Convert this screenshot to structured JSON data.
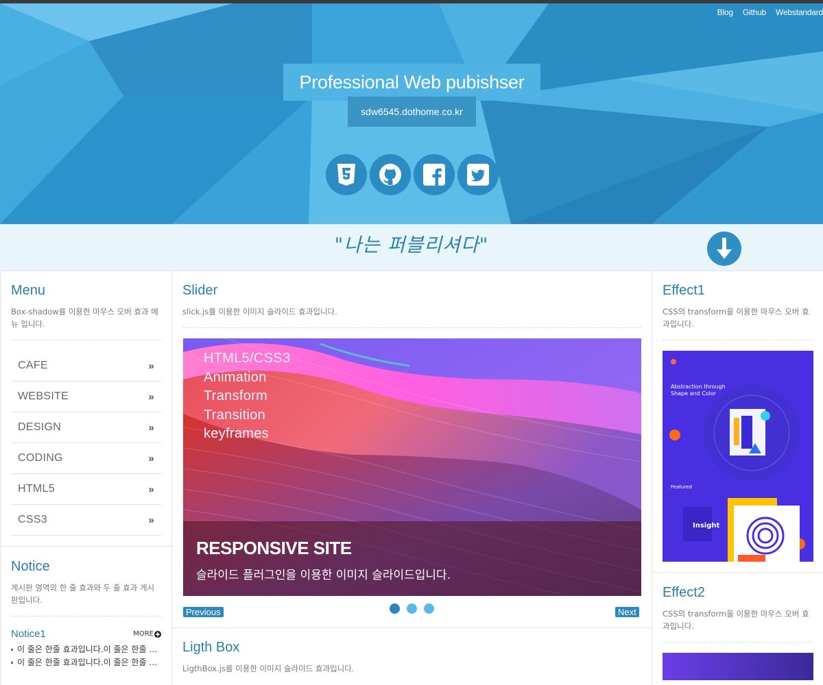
{
  "header": {
    "nav": [
      "Blog",
      "Github",
      "Webstandard"
    ],
    "title": "Professional Web pubishser",
    "url": "sdw6545.dothome.co.kr",
    "social_icons": [
      "html5-icon",
      "github-icon",
      "facebook-icon",
      "twitter-icon"
    ]
  },
  "strip": {
    "slogan": "\"나는 퍼블리셔다\""
  },
  "menu": {
    "title": "Menu",
    "desc": "Box-shadow를 이용한 마우스 오버 효과 메뉴 입니다.",
    "items": [
      {
        "label": "CAFE",
        "chevron": "»"
      },
      {
        "label": "WEBSITE",
        "chevron": "»"
      },
      {
        "label": "DESIGN",
        "chevron": "»"
      },
      {
        "label": "CODING",
        "chevron": "»"
      },
      {
        "label": "HTML5",
        "chevron": "»"
      },
      {
        "label": "CSS3",
        "chevron": "»"
      }
    ]
  },
  "notice": {
    "title": "Notice",
    "desc": "게시판 영역의 한 줄 효과와 두 줄 효과 게시판입니다.",
    "sub_title": "Notice1",
    "more": "MORE",
    "items": [
      "이 줄은 한줄 효과입니다.이 줄은 한줄 효과입니다.",
      "이 줄은 한줄 효과입니다.이 줄은 한줄 효과입니다."
    ]
  },
  "slider": {
    "title": "Slider",
    "desc": "slick.js를 이용한 이미지 슬라이드 효과입니다.",
    "lines": [
      "HTML5/CSS3",
      "Animation",
      "Transform",
      "Transition",
      "keyframes"
    ],
    "caption_title": "RESPONSIVE SITE",
    "caption_text": "슬라이드 플러그인을 이용한 이미지 슬라이드입니다.",
    "prev": "Previous",
    "next": "Next",
    "dots": 3,
    "active_dot": 0
  },
  "lightbox": {
    "title": "Ligth Box",
    "desc": "LigthBox.js를 이용한 이미지 슬라이드 효과입니다."
  },
  "effect1": {
    "title": "Effect1",
    "desc": "CSS의 transform을 이용한 마우스 오버 효과입니다.",
    "thumb_heading": "Abstraction through Shape and Color",
    "thumb_featured": "Featured",
    "thumb_insight": "Insight"
  },
  "effect2": {
    "title": "Effect2",
    "desc": "CSS의 transform을 이용한 마우스 오버 효과입니다."
  },
  "colors": {
    "accent": "#2a7ea8",
    "hero": "#2b97cf",
    "button": "#2e88be"
  }
}
